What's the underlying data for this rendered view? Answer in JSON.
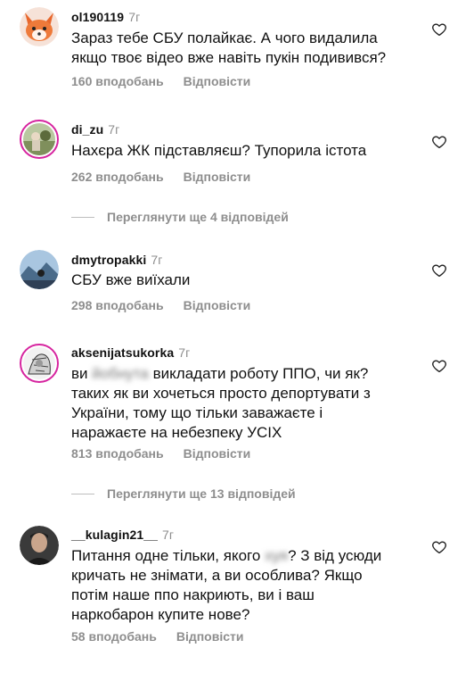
{
  "comments": [
    {
      "username": "ol190119",
      "time": "7г",
      "text": "Зараз тебе СБУ полайкає. А чого видалила\nякщо твоє відео вже навіть пукін подивився?",
      "likes": "160 вподобань",
      "reply": "Відповісти"
    },
    {
      "username": "di_zu",
      "time": "7г",
      "text": "Нахєра ЖК підставляєш? Тупорила істота",
      "likes": "262 вподобань",
      "reply": "Відповісти"
    },
    {
      "username": "dmytropakki",
      "time": "7г",
      "text": "СБУ вже виїхали",
      "likes": "298 вподобань",
      "reply": "Відповісти"
    },
    {
      "username": "aksenijatsukorka",
      "time": "7г",
      "text_start": "ви ",
      "text_blurred": "йобнута",
      "text_end": " викладати роботу ППО, чи як?\nтаких як ви хочеться просто депортувати з\nУкраїни, тому що тільки заважаєте і\nнаражаєте на небезпеку УСІХ",
      "likes": "813 вподобань",
      "reply": "Відповісти"
    },
    {
      "username": "__kulagin21__",
      "time": "7г",
      "text_start": "Питання одне тільки, якого ",
      "text_blurred": "хуя",
      "text_end": "? З від усюди\nкричать не знімати, а ви особлива? Якщо\nпотім наше ппо накриють, ви і ваш\nнаркобарон купите нове?",
      "likes": "58 вподобань",
      "reply": "Відповісти"
    }
  ],
  "view_replies": [
    {
      "label": "Переглянути ще 4 відповідей"
    },
    {
      "label": "Переглянути ще 13 відповідей"
    }
  ],
  "colors": {
    "secondary": "#8e8e8e",
    "story_ring": "#d6249f"
  },
  "icons": {
    "like": "heart-outline-icon"
  }
}
